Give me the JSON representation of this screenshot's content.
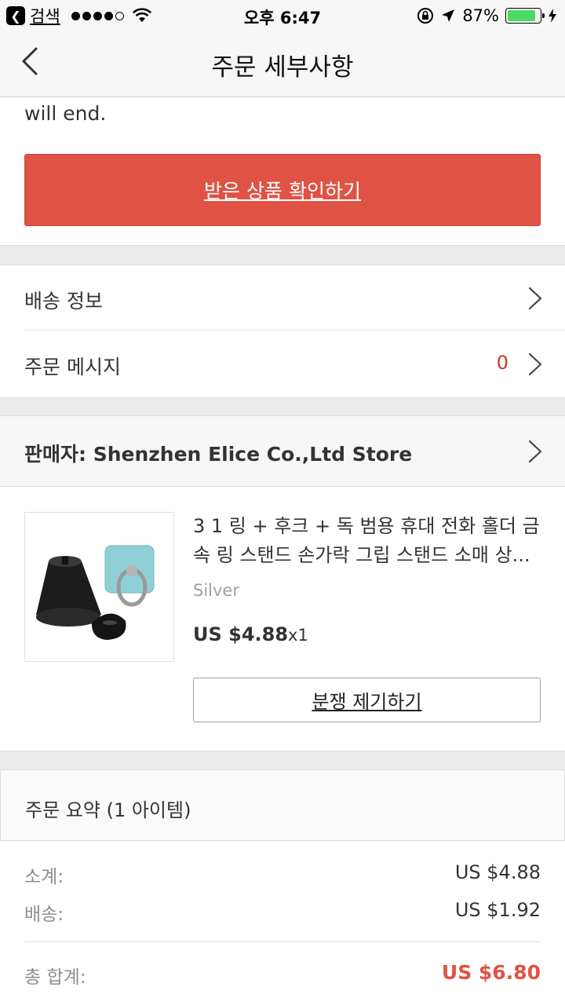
{
  "status_bar": {
    "back_app": "검색",
    "time": "오후 6:47",
    "battery": "87%",
    "battery_level": 0.87
  },
  "nav": {
    "title": "주문 세부사항"
  },
  "notice": {
    "text": "will end."
  },
  "confirm_button": {
    "label": "받은 상품 확인하기"
  },
  "info_rows": {
    "shipping": "배송 정보",
    "messages": "주문 메시지",
    "messages_count": "0"
  },
  "seller": {
    "label": "판매자: Shenzhen Elice Co.,Ltd Store"
  },
  "product": {
    "title": "3 1 링 + 후크 + 독 범용 휴대 전화 홀더 금속 링 스탠드 손가락 그립 스탠드 소매 상...",
    "variant": "Silver",
    "price": "US $4.88",
    "qty": "x1"
  },
  "dispute_button": {
    "label": "분쟁 제기하기"
  },
  "summary": {
    "title": "주문 요약 (1 아이템)",
    "subtotal_label": "소계:",
    "subtotal_value": "US $4.88",
    "shipping_label": "배송:",
    "shipping_value": "US $1.92",
    "total_label": "총 합계:",
    "total_value": "US $6.80"
  },
  "colors": {
    "accent": "#e05244",
    "count": "#d0362a",
    "battery": "#4cd964"
  }
}
